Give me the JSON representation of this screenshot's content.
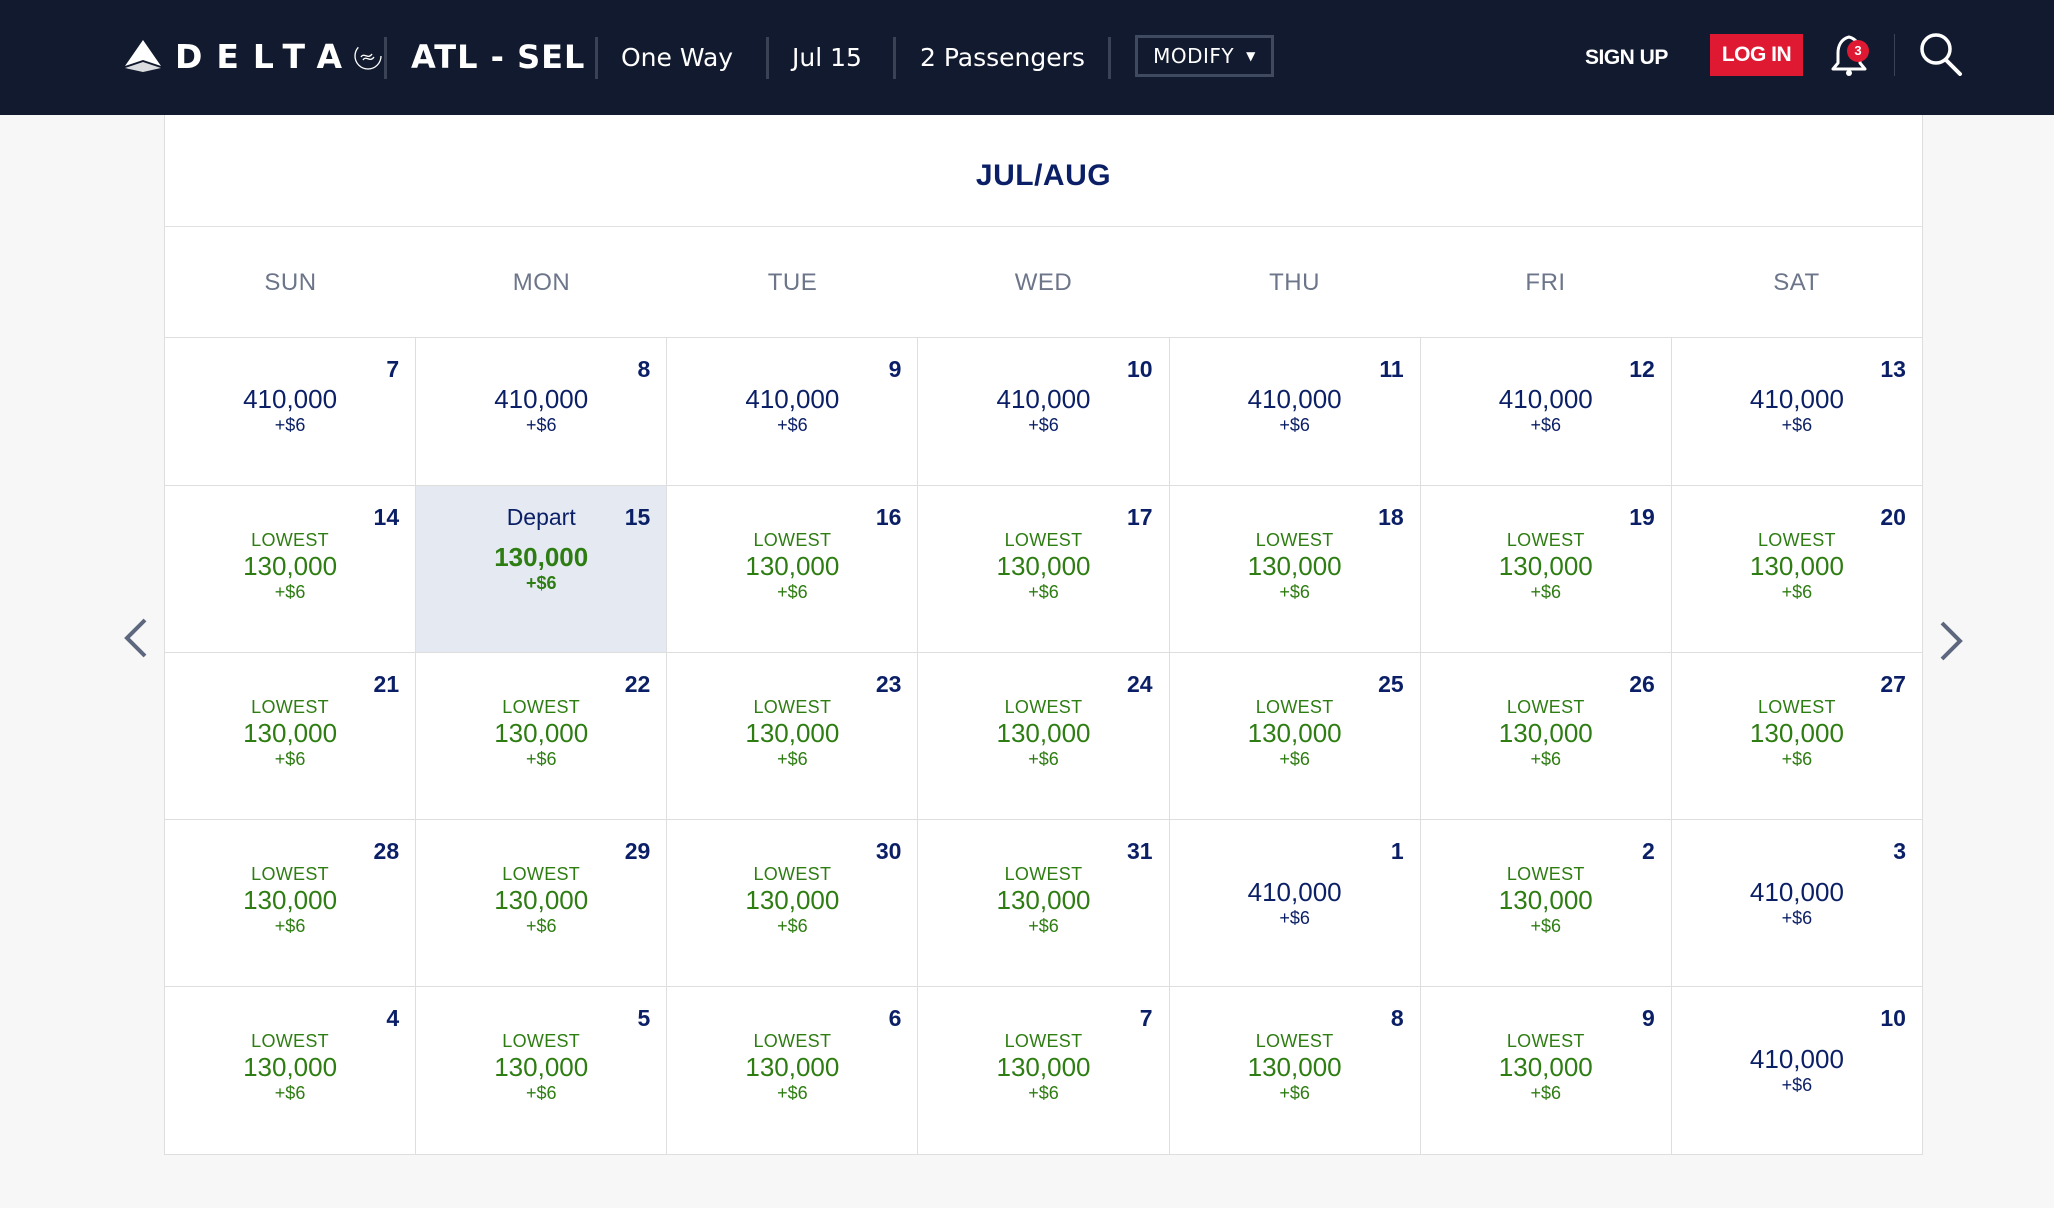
{
  "header": {
    "brand": "DELTA",
    "route": "ATL - SEL",
    "trip_type": "One Way",
    "date": "Jul 15",
    "passengers": "2 Passengers",
    "modify_label": "MODIFY",
    "signup_label": "SIGN UP",
    "login_label": "LOG IN",
    "notification_count": "3"
  },
  "colors": {
    "navbar": "#111a2e",
    "accent_red": "#e01933",
    "navy": "#0b1f66",
    "lowest_green": "#2e7d12",
    "selected_bg": "#e4e9f2"
  },
  "calendar": {
    "title": "JUL/AUG",
    "weekdays": [
      "SUN",
      "MON",
      "TUE",
      "WED",
      "THU",
      "FRI",
      "SAT"
    ],
    "lowest_label": "LOWEST",
    "depart_label": "Depart",
    "weeks": [
      [
        {
          "day": "7",
          "miles": "410,000",
          "fee": "+$6",
          "lowest": false
        },
        {
          "day": "8",
          "miles": "410,000",
          "fee": "+$6",
          "lowest": false
        },
        {
          "day": "9",
          "miles": "410,000",
          "fee": "+$6",
          "lowest": false
        },
        {
          "day": "10",
          "miles": "410,000",
          "fee": "+$6",
          "lowest": false
        },
        {
          "day": "11",
          "miles": "410,000",
          "fee": "+$6",
          "lowest": false
        },
        {
          "day": "12",
          "miles": "410,000",
          "fee": "+$6",
          "lowest": false
        },
        {
          "day": "13",
          "miles": "410,000",
          "fee": "+$6",
          "lowest": false
        }
      ],
      [
        {
          "day": "14",
          "miles": "130,000",
          "fee": "+$6",
          "lowest": true
        },
        {
          "day": "15",
          "miles": "130,000",
          "fee": "+$6",
          "lowest": true,
          "selected": true
        },
        {
          "day": "16",
          "miles": "130,000",
          "fee": "+$6",
          "lowest": true
        },
        {
          "day": "17",
          "miles": "130,000",
          "fee": "+$6",
          "lowest": true
        },
        {
          "day": "18",
          "miles": "130,000",
          "fee": "+$6",
          "lowest": true
        },
        {
          "day": "19",
          "miles": "130,000",
          "fee": "+$6",
          "lowest": true
        },
        {
          "day": "20",
          "miles": "130,000",
          "fee": "+$6",
          "lowest": true
        }
      ],
      [
        {
          "day": "21",
          "miles": "130,000",
          "fee": "+$6",
          "lowest": true
        },
        {
          "day": "22",
          "miles": "130,000",
          "fee": "+$6",
          "lowest": true
        },
        {
          "day": "23",
          "miles": "130,000",
          "fee": "+$6",
          "lowest": true
        },
        {
          "day": "24",
          "miles": "130,000",
          "fee": "+$6",
          "lowest": true
        },
        {
          "day": "25",
          "miles": "130,000",
          "fee": "+$6",
          "lowest": true
        },
        {
          "day": "26",
          "miles": "130,000",
          "fee": "+$6",
          "lowest": true
        },
        {
          "day": "27",
          "miles": "130,000",
          "fee": "+$6",
          "lowest": true
        }
      ],
      [
        {
          "day": "28",
          "miles": "130,000",
          "fee": "+$6",
          "lowest": true
        },
        {
          "day": "29",
          "miles": "130,000",
          "fee": "+$6",
          "lowest": true
        },
        {
          "day": "30",
          "miles": "130,000",
          "fee": "+$6",
          "lowest": true
        },
        {
          "day": "31",
          "miles": "130,000",
          "fee": "+$6",
          "lowest": true
        },
        {
          "day": "1",
          "miles": "410,000",
          "fee": "+$6",
          "lowest": false
        },
        {
          "day": "2",
          "miles": "130,000",
          "fee": "+$6",
          "lowest": true
        },
        {
          "day": "3",
          "miles": "410,000",
          "fee": "+$6",
          "lowest": false
        }
      ],
      [
        {
          "day": "4",
          "miles": "130,000",
          "fee": "+$6",
          "lowest": true
        },
        {
          "day": "5",
          "miles": "130,000",
          "fee": "+$6",
          "lowest": true
        },
        {
          "day": "6",
          "miles": "130,000",
          "fee": "+$6",
          "lowest": true
        },
        {
          "day": "7",
          "miles": "130,000",
          "fee": "+$6",
          "lowest": true
        },
        {
          "day": "8",
          "miles": "130,000",
          "fee": "+$6",
          "lowest": true
        },
        {
          "day": "9",
          "miles": "130,000",
          "fee": "+$6",
          "lowest": true
        },
        {
          "day": "10",
          "miles": "410,000",
          "fee": "+$6",
          "lowest": false
        }
      ]
    ]
  }
}
